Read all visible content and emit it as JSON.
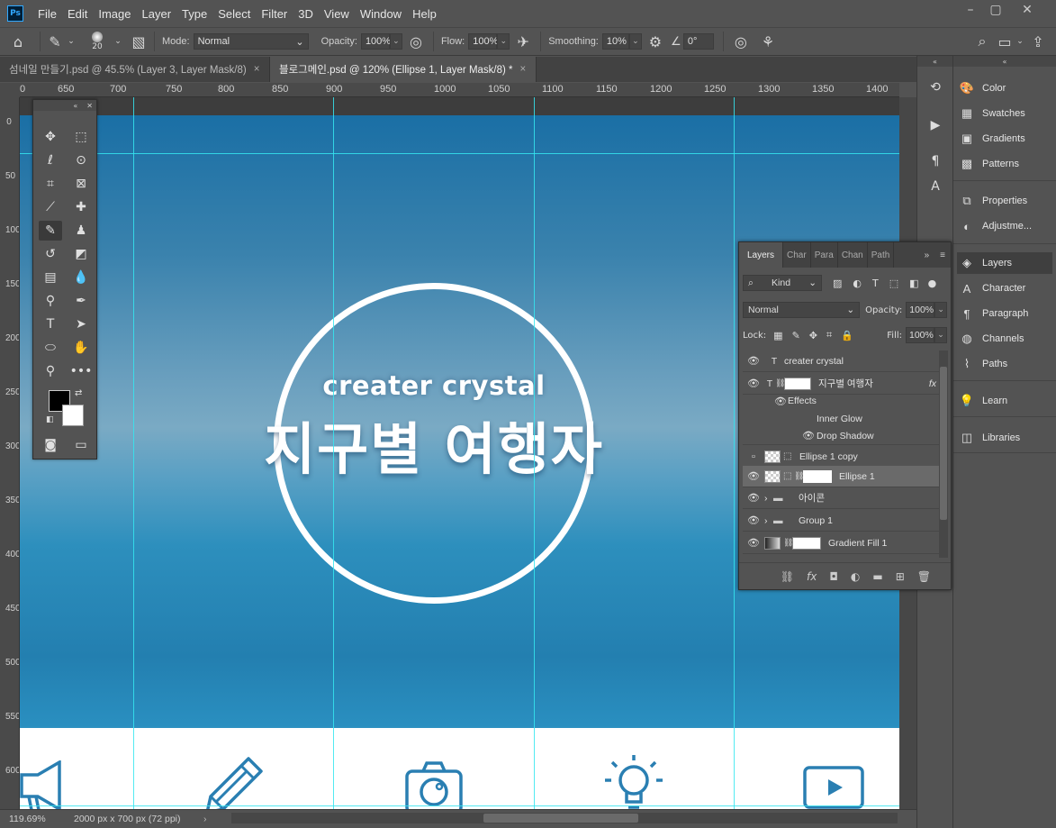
{
  "app": {
    "logo": "Ps"
  },
  "menu": [
    "File",
    "Edit",
    "Image",
    "Layer",
    "Type",
    "Select",
    "Filter",
    "3D",
    "View",
    "Window",
    "Help"
  ],
  "options": {
    "brush_size": "20",
    "mode_label": "Mode:",
    "mode_value": "Normal",
    "opacity_label": "Opacity:",
    "opacity_value": "100%",
    "flow_label": "Flow:",
    "flow_value": "100%",
    "smoothing_label": "Smoothing:",
    "smoothing_value": "10%",
    "angle_value": "0°"
  },
  "tabs": [
    {
      "label": "섬네일 만들기.psd @ 45.5% (Layer 3, Layer Mask/8)"
    },
    {
      "label": "블로그메인.psd @ 120% (Ellipse 1, Layer Mask/8) *"
    }
  ],
  "ruler": {
    "top": [
      "0",
      "650",
      "700",
      "750",
      "800",
      "850",
      "900",
      "950",
      "1000",
      "1050",
      "1100",
      "1150",
      "1200",
      "1250",
      "1300",
      "1350",
      "1400"
    ],
    "left": [
      "0",
      "50",
      "100",
      "150",
      "200",
      "250",
      "300",
      "350",
      "400",
      "450",
      "500",
      "550",
      "600"
    ]
  },
  "canvas": {
    "title_small": "creater crystal",
    "title_big": "지구별 여행자"
  },
  "status": {
    "zoom": "119.69%",
    "doc_size": "2000 px x 700 px (72 ppi)"
  },
  "dock": {
    "items": [
      {
        "label": "Color",
        "icon": "palette-icon"
      },
      {
        "label": "Swatches",
        "icon": "grid-icon"
      },
      {
        "label": "Gradients",
        "icon": "gradient-icon"
      },
      {
        "label": "Patterns",
        "icon": "pattern-icon"
      },
      {
        "label": "Properties",
        "icon": "properties-icon"
      },
      {
        "label": "Adjustme...",
        "icon": "adjustments-icon"
      },
      {
        "label": "Layers",
        "icon": "layers-icon"
      },
      {
        "label": "Character",
        "icon": "character-icon"
      },
      {
        "label": "Paragraph",
        "icon": "paragraph-icon"
      },
      {
        "label": "Channels",
        "icon": "channels-icon"
      },
      {
        "label": "Paths",
        "icon": "paths-icon"
      },
      {
        "label": "Learn",
        "icon": "lightbulb-icon"
      },
      {
        "label": "Libraries",
        "icon": "libraries-icon"
      }
    ]
  },
  "layers_panel": {
    "tabs": [
      "Layers",
      "Char",
      "Para",
      "Chan",
      "Path"
    ],
    "kind": "Kind",
    "blend": "Normal",
    "opacity_label": "Opacity:",
    "opacity_value": "100%",
    "lock_label": "Lock:",
    "fill_label": "Fill:",
    "fill_value": "100%",
    "layers": [
      {
        "name": "creater crystal"
      },
      {
        "name": "지구별 여행자"
      },
      {
        "name": "Effects"
      },
      {
        "name": "Inner Glow"
      },
      {
        "name": "Drop Shadow"
      },
      {
        "name": "Ellipse 1 copy"
      },
      {
        "name": "Ellipse 1"
      },
      {
        "name": "아이콘"
      },
      {
        "name": "Group 1"
      },
      {
        "name": "Gradient Fill 1"
      }
    ]
  }
}
